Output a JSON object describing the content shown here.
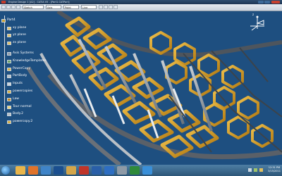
{
  "window": {
    "title": "Engine Design 1 [A2] - CATIA V5 - [Part1.CATPart]",
    "controls": [
      "minimize",
      "maximize",
      "close"
    ]
  },
  "toolbar": {
    "combos": [
      "Sketch",
      "Axis",
      "Point",
      "Line"
    ],
    "icons": [
      "new-icon",
      "open-icon",
      "save-icon",
      "undo-icon",
      "redo-icon",
      "zoom-icon",
      "rotate-icon",
      "measure-icon"
    ]
  },
  "tree": {
    "items": [
      {
        "label": "Part4",
        "icon": "part-icon"
      },
      {
        "label": "xy plane",
        "icon": "plane-icon"
      },
      {
        "label": "yz plane",
        "icon": "plane-icon"
      },
      {
        "label": "zx plane",
        "icon": "plane-icon"
      },
      {
        "label": "Axis Systems",
        "icon": "axis-icon"
      },
      {
        "label": "KnowledgeTemplates",
        "icon": "knowledge-icon"
      },
      {
        "label": "PowerCopy",
        "icon": "powercopy-icon"
      },
      {
        "label": "PartBody",
        "icon": "body-icon"
      },
      {
        "label": "Inputs",
        "icon": "input-icon"
      },
      {
        "label": "powercopies",
        "icon": "powercopy-icon"
      },
      {
        "label": "Law",
        "icon": "law-icon"
      },
      {
        "label": "Tour normal",
        "icon": "feature-icon"
      },
      {
        "label": "Body.2",
        "icon": "body-icon"
      },
      {
        "label": "powercopy.2",
        "icon": "powercopy-icon"
      }
    ]
  },
  "compass": {
    "axis_label": "z"
  },
  "taskbar": {
    "apps": [
      "explorer-icon",
      "firefox-icon",
      "media-icon",
      "catia-icon",
      "folder-icon",
      "acrobat-icon",
      "photoshop-icon",
      "word-icon",
      "calc-icon",
      "excel-icon",
      "ie-icon"
    ],
    "clock_time": "12:31 PM",
    "clock_date": "3/15/2011"
  },
  "colors": {
    "viewport_bg": "#1e4f80",
    "beam_gold": "#d9a127",
    "beam_grey": "#9aa1a8",
    "beam_white": "#e8ecef",
    "beam_dark": "#5a6068"
  }
}
